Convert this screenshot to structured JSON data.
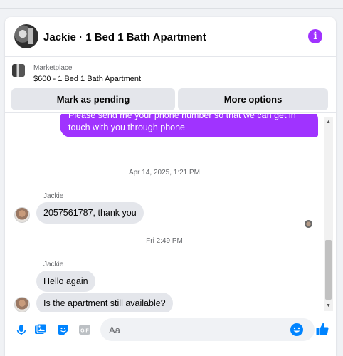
{
  "header": {
    "title": "Jackie · 1 Bed 1 Bath Apartment"
  },
  "marketplace": {
    "label": "Marketplace",
    "listing": "$600 - 1 Bed 1 Bath Apartment",
    "actions": {
      "pending": "Mark as pending",
      "more": "More options"
    }
  },
  "messages": {
    "outgoing": "Please send me your phone  number so that we can get in touch with you through phone",
    "timestamp1": "Apr 14, 2025, 1:21 PM",
    "group1": {
      "sender": "Jackie",
      "text": "2057561787, thank you"
    },
    "timestamp2": "Fri 2:49 PM",
    "group2": {
      "sender": "Jackie",
      "text1": "Hello again",
      "text2": "Is the apartment still available?"
    }
  },
  "composer": {
    "placeholder": "Aa",
    "icons": [
      "microphone-icon",
      "photo-icon",
      "sticker-icon",
      "gif-icon",
      "emoji-icon",
      "thumbs-up-icon"
    ]
  },
  "colors": {
    "accent": "#a033ff",
    "like": "#0084ff",
    "bubble_in": "#e4e6eb"
  }
}
